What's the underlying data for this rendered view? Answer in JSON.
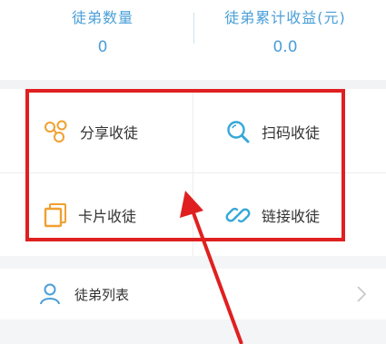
{
  "stats": [
    {
      "label": "徒弟数量",
      "value": "0"
    },
    {
      "label": "徒弟累计收益(元)",
      "value": "0.0"
    }
  ],
  "actions": [
    {
      "label": "分享收徒",
      "icon": "share-icon"
    },
    {
      "label": "扫码收徒",
      "icon": "search-icon"
    },
    {
      "label": "卡片收徒",
      "icon": "card-icon"
    },
    {
      "label": "链接收徒",
      "icon": "link-icon"
    }
  ],
  "list": {
    "label": "徒弟列表",
    "icon": "user-icon"
  },
  "colors": {
    "accent": "#4a9fd8",
    "icon_orange": "#f0a030",
    "icon_blue": "#35a8d8",
    "highlight": "#e02020"
  }
}
